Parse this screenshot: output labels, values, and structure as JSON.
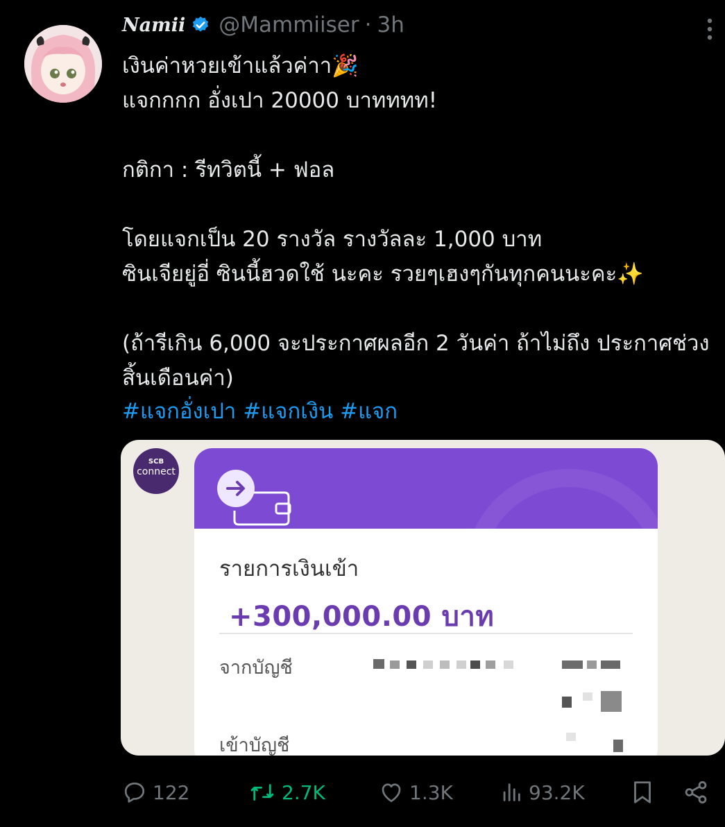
{
  "tweet": {
    "author": {
      "display_name": "Namii",
      "handle": "@Mammiiser",
      "separator": "·",
      "time": "3h",
      "verified": true
    },
    "text": "เงินค่าหวยเข้าแล้วค่าา🎉\nแจกกกก อั่งเปา 20000 บาทททท!\n\nกติกา : รีทวิตนี้ + ฟอล\n\nโดยแจกเป็น 20 รางวัล รางวัลละ 1,000 บาท\nซินเจียยู่อี่ ซินนี้ฮวดใช้ นะคะ รวยๆเฮงๆกันทุกคนนะคะ✨\n\n(ถ้ารีเกิน 6,000 จะประกาศผลอีก 2 วันค่า ถ้าไม่ถึง ประกาศช่วงสิ้นเดือนค่า)",
    "hashtags": [
      "#แจกอั่งเปา",
      "#แจกเงิน",
      "#แจก"
    ],
    "media": {
      "logo_top": "SCB",
      "logo_bottom": "connect",
      "card_title": "รายการเงินเข้า",
      "amount": "+300,000.00 บาท",
      "from_label": "จากบัญชี",
      "to_label": "เข้าบัญชี"
    },
    "actions": {
      "replies": "122",
      "retweets": "2.7K",
      "likes": "1.3K",
      "views": "93.2K"
    }
  },
  "colors": {
    "background": "#000000",
    "text": "#e7e9ea",
    "secondary": "#71767b",
    "link": "#1d9bf0",
    "retweet": "#00ba7c",
    "scb_purple": "#7d4ad4"
  },
  "icons": [
    "reply-icon",
    "retweet-icon",
    "like-icon",
    "views-icon",
    "bookmark-icon",
    "share-icon",
    "more-icon",
    "verified-icon"
  ]
}
